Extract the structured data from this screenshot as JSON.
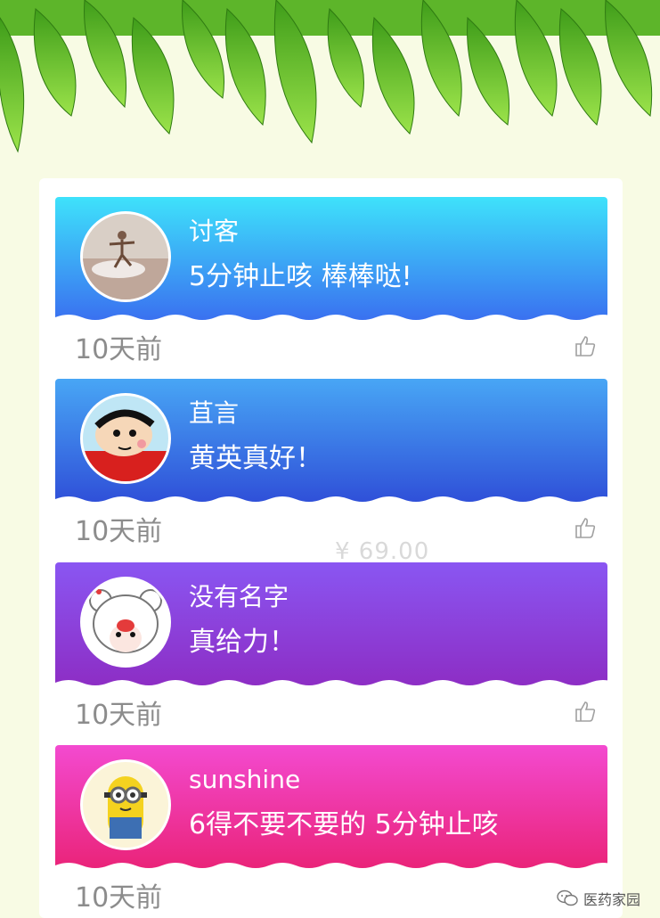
{
  "price_watermark": "¥ 69.00",
  "reviews": [
    {
      "username": "讨客",
      "comment": "5分钟止咳 棒棒哒!",
      "time": "10天前",
      "avatar": "photo-avatar"
    },
    {
      "username": "苴言",
      "comment": "黄英真好！",
      "time": "10天前",
      "avatar": "cartoon-boy-avatar"
    },
    {
      "username": "没有名字",
      "comment": "真给力！",
      "time": "10天前",
      "avatar": "cartoon-bear-girl-avatar"
    },
    {
      "username": "sunshine",
      "comment": "6得不要不要的 5分钟止咳",
      "time": "10天前",
      "avatar": "minion-avatar"
    }
  ],
  "icons": {
    "like": "thumbs-up-icon",
    "wechat": "wechat-icon"
  },
  "colors": {
    "card1": [
      "#3ee2fb",
      "#3a6ff0"
    ],
    "card2": [
      "#48a6f5",
      "#2f4fd8"
    ],
    "card3": [
      "#8a56f2",
      "#8d2dc4"
    ],
    "card4": [
      "#f34ad0",
      "#ea2378"
    ]
  },
  "footer": {
    "watermark": "医药家园"
  }
}
